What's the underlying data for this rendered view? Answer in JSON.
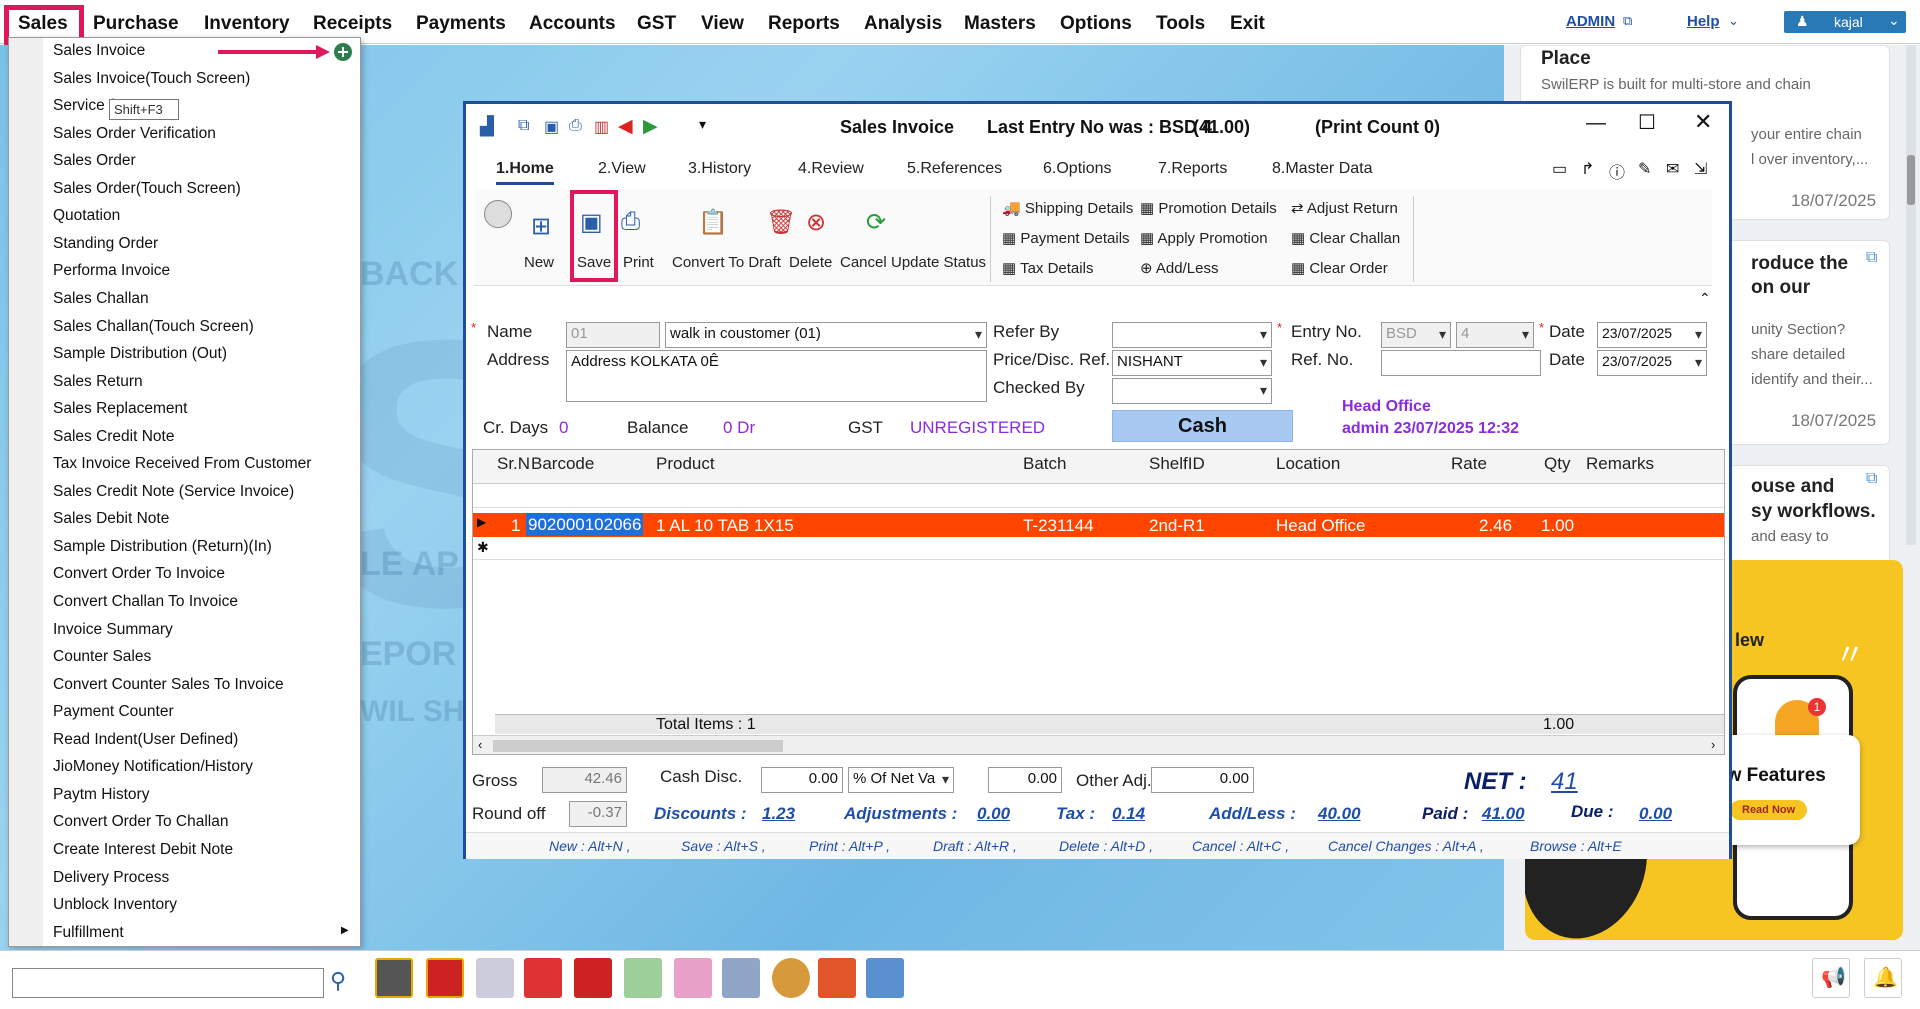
{
  "menubar": {
    "items": [
      "Sales",
      "Purchase",
      "Inventory",
      "Receipts",
      "Payments",
      "Accounts",
      "GST",
      "View",
      "Reports",
      "Analysis",
      "Masters",
      "Options",
      "Tools",
      "Exit"
    ],
    "admin": "ADMIN",
    "help": "Help",
    "user": "kajal"
  },
  "sales_menu": {
    "items": [
      "Sales Invoice",
      "Sales Invoice(Touch Screen)",
      "Service (",
      "Sales Order Verification",
      "Sales Order",
      "Sales Order(Touch Screen)",
      "Quotation",
      "Standing Order",
      "Performa Invoice",
      "Sales Challan",
      "Sales Challan(Touch Screen)",
      "Sample Distribution (Out)",
      "Sales Return",
      "Sales Replacement",
      "Sales Credit Note",
      "Tax Invoice Received From Customer",
      "Sales Credit Note (Service Invoice)",
      "Sales Debit Note",
      "Sample Distribution (Return)(In)",
      "Convert Order To Invoice",
      "Convert Challan To Invoice",
      "Invoice Summary",
      "Counter Sales",
      "Convert Counter Sales To Invoice",
      "Payment Counter",
      "Read Indent(User Defined)",
      "JioMoney Notification/History",
      "Paytm History",
      "Convert Order To Challan",
      "Create Interest Debit Note",
      "Delivery Process",
      "Unblock Inventory",
      "Fulfillment"
    ],
    "tooltip": "Shift+F3"
  },
  "window": {
    "title": "Sales Invoice",
    "last_entry": "Last Entry No was : BSD 4",
    "last_entry_amount": "(41.00)",
    "print_count": "(Print Count 0)",
    "tabs": [
      "1.Home",
      "2.View",
      "3.History",
      "4.Review",
      "5.References",
      "6.Options",
      "7.Reports",
      "8.Master Data"
    ],
    "toolbar": [
      "New",
      "Save",
      "Print",
      "Convert To Draft",
      "Delete",
      "Cancel",
      "Update Status"
    ],
    "ribbon": {
      "col1": [
        "Shipping Details",
        "Payment Details",
        "Tax Details"
      ],
      "col2": [
        "Promotion Details",
        "Apply Promotion",
        "Add/Less"
      ],
      "col3": [
        "Adjust Return",
        "Clear Challan",
        "Clear Order"
      ]
    }
  },
  "form": {
    "name_label": "Name",
    "name_code": "01",
    "name_value": "walk in coustomer (01)",
    "address_label": "Address",
    "address_value": "Address  KOLKATA 0Ê",
    "refer_by_label": "Refer By",
    "price_ref_label": "Price/Disc. Ref.",
    "price_ref_value": "NISHANT",
    "checked_by_label": "Checked By",
    "entry_no_label": "Entry No.",
    "entry_series": "BSD",
    "entry_no": "4",
    "date_label": "Date",
    "date_value": "23/07/2025",
    "ref_no_label": "Ref. No.",
    "date2_label": "Date",
    "date2_value": "23/07/2025",
    "cr_days_label": "Cr. Days",
    "cr_days_value": "0",
    "balance_label": "Balance",
    "balance_value": "0 Dr",
    "gst_label": "GST",
    "gst_value": "UNREGISTERED",
    "cash_button": "Cash",
    "head_office": "Head Office",
    "admin_stamp": "admin 23/07/2025 12:32"
  },
  "grid": {
    "headers": [
      "Sr.N",
      "Barcode",
      "Product",
      "Batch",
      "ShelfID",
      "Location",
      "Rate",
      "Qty",
      "Remarks"
    ],
    "rows": [
      {
        "sr": "1",
        "barcode": "902000102066",
        "product": "1 AL 10 TAB 1X15",
        "batch": "T-231144",
        "shelf": "2nd-R1",
        "location": "Head Office",
        "rate": "2.46",
        "qty": "1.00"
      }
    ],
    "total_items": "Total Items : 1",
    "total_qty": "1.00"
  },
  "summary": {
    "gross_label": "Gross",
    "gross": "42.46",
    "cash_disc_label": "Cash Disc.",
    "cash_disc": "0.00",
    "disc_type": "% Of Net Va",
    "disc_amt": "0.00",
    "other_adj_label": "Other Adj.",
    "other_adj": "0.00",
    "net_label": "NET :",
    "net": "41",
    "round_off_label": "Round off",
    "round_off": "-0.37",
    "discounts_label": "Discounts :",
    "discounts": "1.23",
    "adjustments_label": "Adjustments :",
    "adjustments": "0.00",
    "tax_label": "Tax :",
    "tax": "0.14",
    "addless_label": "Add/Less :",
    "addless": "40.00",
    "paid_label": "Paid :",
    "paid": "41.00",
    "due_label": "Due :",
    "due": "0.00"
  },
  "shortcuts": [
    "New : Alt+N ,",
    "Save : Alt+S ,",
    "Print : Alt+P ,",
    "Draft : Alt+R ,",
    "Delete : Alt+D ,",
    "Cancel : Alt+C ,",
    "Cancel Changes : Alt+A ,",
    "Browse : Alt+E"
  ],
  "side": {
    "card1_title": "Place",
    "card1_sub": "SwilERP is built for multi-store and chain",
    "card1_sub2": "your entire chain",
    "card1_sub3": "l over inventory,...",
    "card1_date": "18/07/2025",
    "card2_title": "roduce the",
    "card2_title2": "on our",
    "card2_sub": "unity Section?",
    "card2_sub2": "share detailed",
    "card2_sub3": "identify and their...",
    "card2_date": "18/07/2025",
    "card3_title": "ouse and",
    "card3_title2": "sy workflows.",
    "card3_sub": "and easy to",
    "promo_new": "lew",
    "promo_feat": "ew Features",
    "promo_read": "Read Now",
    "promo_badge": "1"
  }
}
